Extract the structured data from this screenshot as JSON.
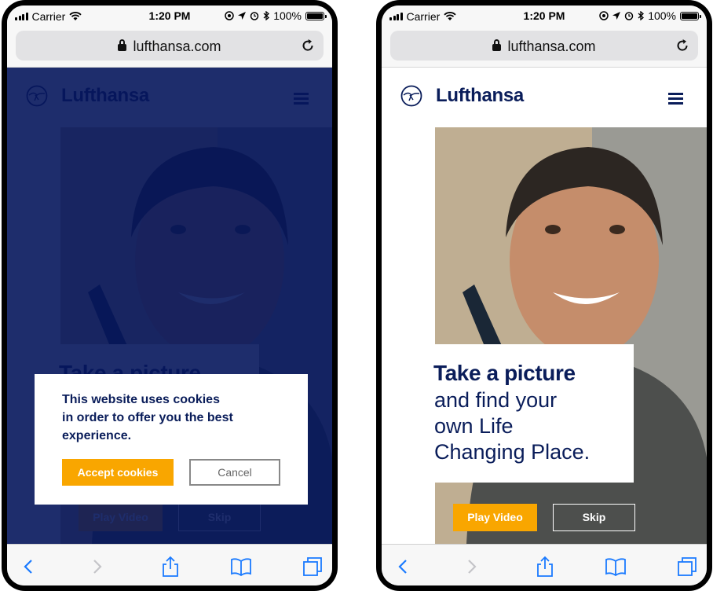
{
  "status_bar": {
    "carrier": "Carrier",
    "time": "1:20 PM",
    "battery": "100%"
  },
  "browser": {
    "url": "lufthansa.com"
  },
  "site": {
    "brand": "Lufthansa",
    "brand_color": "#0a1d5a",
    "accent_color": "#f9a600"
  },
  "hero": {
    "title": "Take a picture",
    "subtitle_lines": [
      "and find your",
      "own Life",
      "Changing Place."
    ],
    "play_button": "Play Video",
    "skip_button": "Skip"
  },
  "cookie_dialog": {
    "message_lines": [
      "This website uses cookies",
      "in order to offer you the best",
      "experience."
    ],
    "accept_button": "Accept cookies",
    "cancel_button": "Cancel"
  },
  "toolbar": {
    "icons": [
      "back-icon",
      "forward-icon",
      "share-icon",
      "bookmarks-icon",
      "tabs-icon"
    ]
  }
}
